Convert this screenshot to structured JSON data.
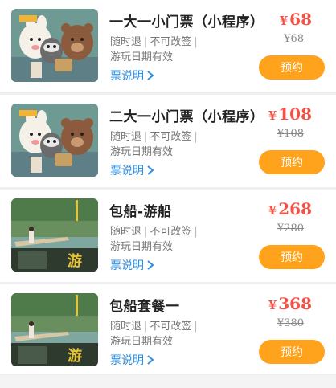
{
  "tickets": [
    {
      "title": "一大一小门票（小程序）",
      "tag1": "随时退",
      "tag2": "不可改签",
      "validity": "游玩日期有效",
      "desc_link": "票说明",
      "currency": "¥",
      "price": "68",
      "original_price": "¥68",
      "book_label": "预约",
      "image": "cartoon-animals-image"
    },
    {
      "title": "二大一小门票（小程序）",
      "tag1": "随时退",
      "tag2": "不可改签",
      "validity": "游玩日期有效",
      "desc_link": "票说明",
      "currency": "¥",
      "price": "108",
      "original_price": "¥108",
      "book_label": "预约",
      "image": "cartoon-animals-image"
    },
    {
      "title": "包船-游船",
      "tag1": "随时退",
      "tag2": "不可改签",
      "validity": "游玩日期有效",
      "desc_link": "票说明",
      "currency": "¥",
      "price": "268",
      "original_price": "¥280",
      "book_label": "预约",
      "image": "lake-boat-image"
    },
    {
      "title": "包船套餐一",
      "tag1": "随时退",
      "tag2": "不可改签",
      "validity": "游玩日期有效",
      "desc_link": "票说明",
      "currency": "¥",
      "price": "368",
      "original_price": "¥380",
      "book_label": "预约",
      "image": "lake-boat-image"
    }
  ],
  "colors": {
    "price": "#f25346",
    "button": "#ffa21c",
    "link": "#2e8fe3"
  },
  "icons": {
    "link_chevron": "chevron-right-icon"
  }
}
